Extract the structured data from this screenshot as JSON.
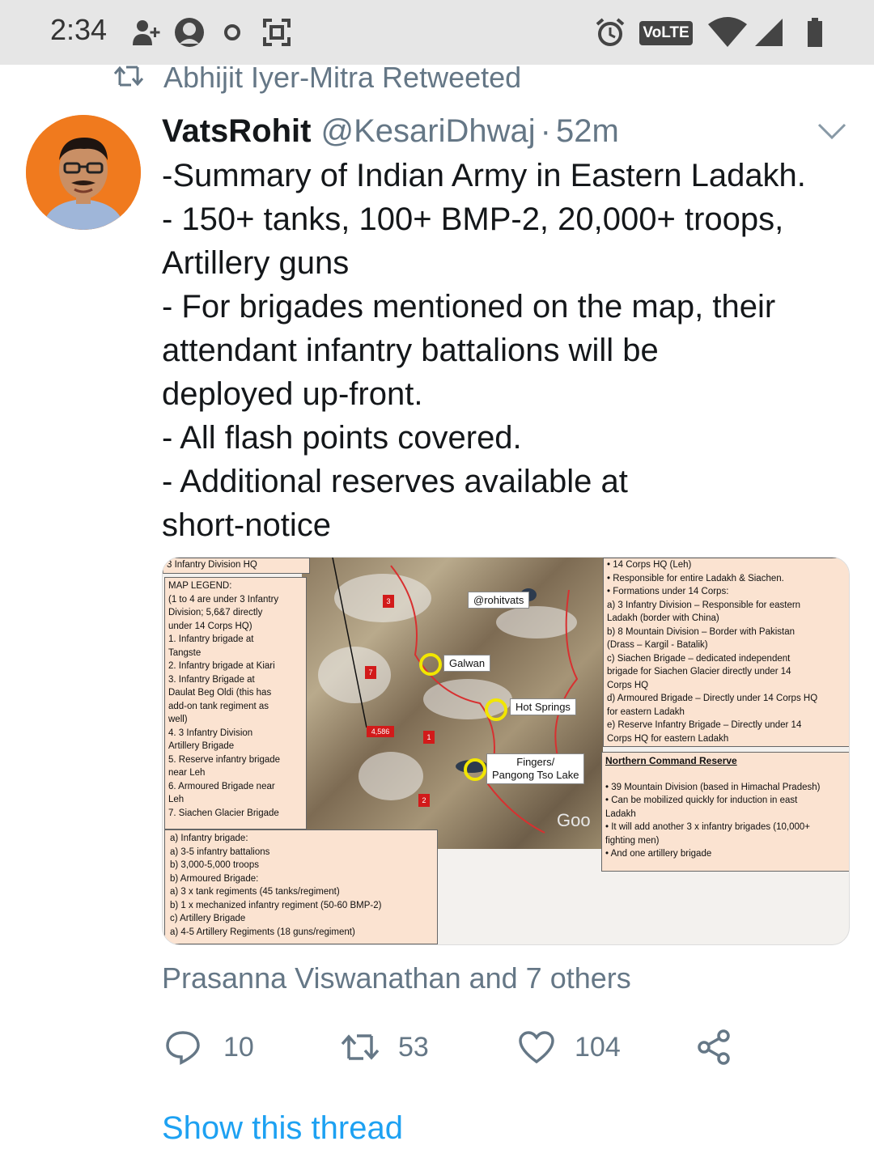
{
  "status_bar": {
    "time": "2:34",
    "volte": "VoLTE",
    "icons": [
      "add-person-icon",
      "profile-notification-icon",
      "circle-notification-icon",
      "screenshot-icon",
      "alarm-icon",
      "wifi-icon",
      "signal-icon",
      "battery-icon"
    ]
  },
  "retweet_context": {
    "text": "Abhijit Iyer-Mitra Retweeted"
  },
  "tweet": {
    "author_name": "VatsRohit",
    "handle": "@KesariDhwaj",
    "separator": "·",
    "time": "52m",
    "lines": [
      "-Summary of Indian Army in Eastern Ladakh.",
      "- 150+ tanks, 100+ BMP-2, 20,000+ troops,",
      "Artillery guns",
      "- For brigades mentioned on the map, their",
      "attendant infantry battalions will be",
      "deployed up-front.",
      "- All flash points covered.",
      "- Additional reserves available at",
      "short-notice"
    ]
  },
  "media": {
    "top_left_label": "3 Infantry Division HQ",
    "legend": [
      "MAP LEGEND:",
      "(1 to 4 are under 3 Infantry",
      "Division; 5,6&7 directly",
      "under 14 Corps HQ)",
      "1.  Infantry brigade at",
      "     Tangste",
      "2.  Infantry brigade at Kiari",
      "3.  Infantry Brigade at",
      "     Daulat Beg Oldi (this has",
      "     add-on tank regiment as",
      "     well)",
      "4.  3 Infantry Division",
      "     Artillery Brigade",
      "5.  Reserve infantry brigade",
      "     near Leh",
      "6.  Armoured Brigade near",
      "     Leh",
      "7.  Siachen Glacier Brigade"
    ],
    "bottom_box": [
      "a)  Infantry brigade:",
      "     a)  3-5 infantry battalions",
      "     b)  3,000-5,000 troops",
      "b)  Armoured Brigade:",
      "     a)  3 x tank regiments (45 tanks/regiment)",
      "     b)  1 x mechanized infantry regiment (50-60 BMP-2)",
      "c)  Artillery Brigade",
      "     a)  4-5 Artillery Regiments (18 guns/regiment)"
    ],
    "right_box": [
      "•   14 Corps HQ (Leh)",
      "•   Responsible for entire Ladakh & Siachen.",
      "•   Formations under 14 Corps:",
      "a)  3 Infantry Division – Responsible for eastern",
      "     Ladakh (border with China)",
      "b)  8 Mountain Division – Border with Pakistan",
      "     (Drass – Kargil - Batalik)",
      "c)  Siachen Brigade – dedicated independent",
      "     brigade for Siachen Glacier directly under 14",
      "     Corps HQ",
      "d)  Armoured Brigade – Directly under 14 Corps HQ",
      "     for eastern Ladakh",
      "e)  Reserve Infantry Brigade – Directly under 14",
      "     Corps HQ for eastern Ladakh"
    ],
    "reserve_title": "Northern Command Reserve",
    "reserve_box": [
      "•  39 Mountain Division (based in Himachal Pradesh)",
      "•  Can be mobilized quickly for induction in east",
      "    Ladakh",
      "•  It will add another 3 x infantry brigades (10,000+",
      "    fighting men)",
      "•  And one artillery brigade"
    ],
    "map_labels": {
      "watermark": "@rohitvats",
      "galwan": "Galwan",
      "hot_springs": "Hot Springs",
      "fingers_1": "Fingers/",
      "fingers_2": "Pangong Tso Lake",
      "height": "4,586",
      "google": "Goo",
      "m1": "1",
      "m2": "2",
      "m3": "3",
      "m7": "7"
    }
  },
  "likers": "Prasanna Viswanathan and 7 others",
  "actions": {
    "replies": "10",
    "retweets": "53",
    "likes": "104"
  },
  "show_thread": "Show this thread"
}
